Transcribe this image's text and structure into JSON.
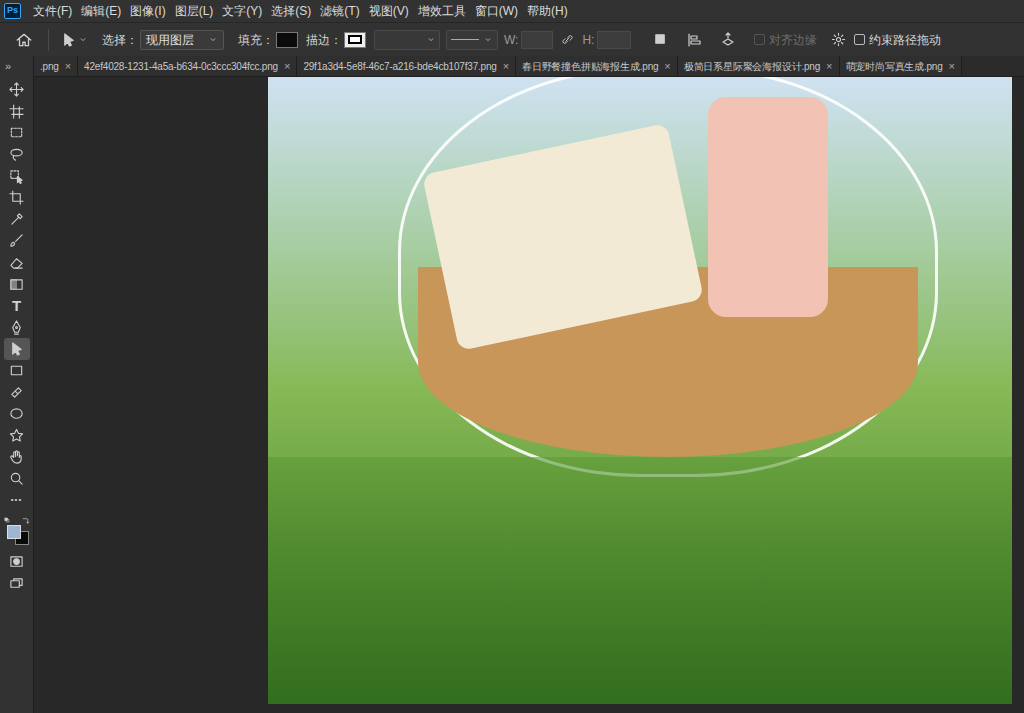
{
  "app": {
    "logo": "Ps"
  },
  "menu": [
    "文件(F)",
    "编辑(E)",
    "图像(I)",
    "图层(L)",
    "文字(Y)",
    "选择(S)",
    "滤镜(T)",
    "视图(V)",
    "增效工具",
    "窗口(W)",
    "帮助(H)"
  ],
  "options": {
    "select_label": "选择：",
    "select_value": "现用图层",
    "fill_label": "填充：",
    "fill_color": "#0b0b0b",
    "stroke_label": "描边：",
    "w_label": "W:",
    "h_label": "H:",
    "align_edges": {
      "label": "对齐边缘",
      "checked": false,
      "disabled": true
    },
    "constrain_path": {
      "label": "约束路径拖动",
      "checked": false
    }
  },
  "panel_toggle": "»",
  "tabs": [
    {
      "label": ".png",
      "close": "×",
      "selected": false
    },
    {
      "label": "42ef4028-1231-4a5a-b634-0c3ccc304fcc.png",
      "close": "×",
      "selected": false
    },
    {
      "label": "29f1a3d4-5e8f-46c7-a216-bde4cb107f37.png",
      "close": "×",
      "selected": false
    },
    {
      "label": "春日野餐撞色拼贴海报生成.png",
      "close": "×",
      "selected": false
    },
    {
      "label": "极简日系星际聚会海报设计.png",
      "close": "×",
      "selected": false
    },
    {
      "label": "萌宠时尚写真生成.png",
      "close": "×",
      "selected": false
    }
  ],
  "tools": [
    {
      "kind": "move",
      "selected": false
    },
    {
      "kind": "artboard",
      "selected": false
    },
    {
      "kind": "marquee",
      "selected": false
    },
    {
      "kind": "lasso",
      "selected": false
    },
    {
      "kind": "objectselect",
      "selected": false
    },
    {
      "kind": "crop",
      "selected": false
    },
    {
      "kind": "eyedropper",
      "selected": false
    },
    {
      "kind": "brush",
      "selected": false
    },
    {
      "kind": "eraser",
      "selected": false
    },
    {
      "kind": "gradient",
      "selected": false
    },
    {
      "kind": "type",
      "glyph": "T",
      "selected": false
    },
    {
      "kind": "pen",
      "selected": false
    },
    {
      "kind": "pathselect",
      "selected": true
    },
    {
      "kind": "rectangle",
      "selected": false
    },
    {
      "kind": "healing",
      "selected": false
    },
    {
      "kind": "ellipse",
      "selected": false
    },
    {
      "kind": "shape",
      "selected": false
    },
    {
      "kind": "hand",
      "selected": false
    },
    {
      "kind": "zoom",
      "selected": false
    },
    {
      "kind": "more",
      "glyph": "•••",
      "selected": false
    }
  ],
  "colors": {
    "foreground": "#9fb6d2",
    "background": "#0a0a0a"
  },
  "tools_bottom": [
    {
      "kind": "quickmask",
      "selected": false
    },
    {
      "kind": "screenmode",
      "selected": false
    }
  ]
}
